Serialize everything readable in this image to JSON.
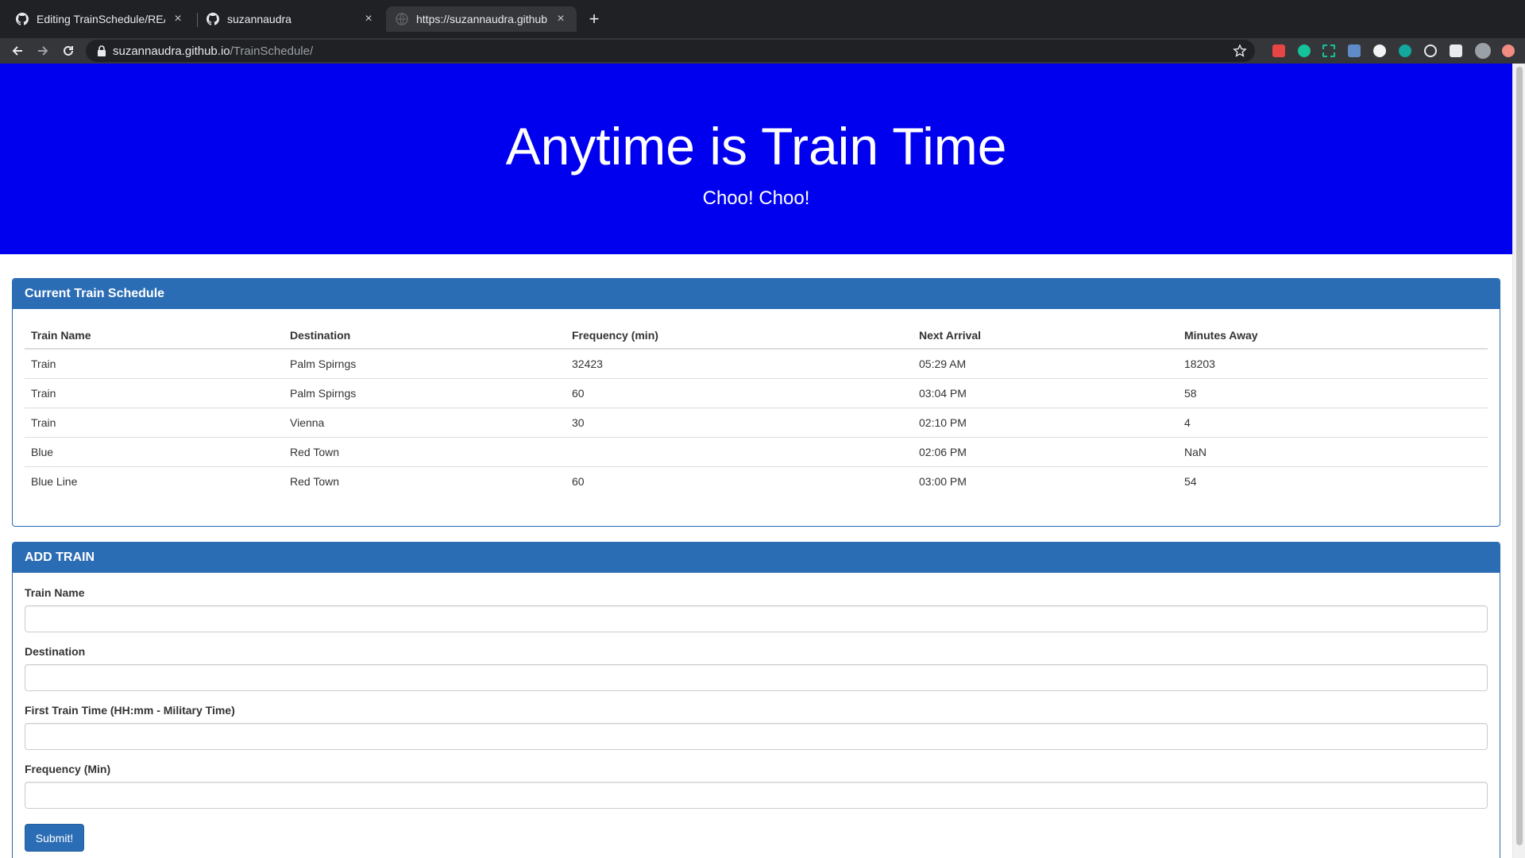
{
  "browser": {
    "tabs": [
      {
        "title": "Editing TrainSchedule/READM",
        "icon": "github-icon"
      },
      {
        "title": "suzannaudra",
        "icon": "github-icon"
      },
      {
        "title": "https://suzannaudra.github.io/",
        "icon": "globe-icon"
      }
    ],
    "new_tab": "+",
    "url_host": "suzannaudra.github.io",
    "url_path": "/TrainSchedule/"
  },
  "jumbotron": {
    "title": "Anytime is Train Time",
    "subtitle": "Choo! Choo!",
    "background": "#0000ee"
  },
  "schedule": {
    "heading": "Current Train Schedule",
    "columns": [
      "Train Name",
      "Destination",
      "Frequency (min)",
      "Next Arrival",
      "Minutes Away"
    ],
    "rows": [
      [
        "Train",
        "Palm Spirngs",
        "32423",
        "05:29 AM",
        "18203"
      ],
      [
        "Train",
        "Palm Spirngs",
        "60",
        "03:04 PM",
        "58"
      ],
      [
        "Train",
        "Vienna",
        "30",
        "02:10 PM",
        "4"
      ],
      [
        "Blue",
        "Red Town",
        "",
        "02:06 PM",
        "NaN"
      ],
      [
        "Blue Line",
        "Red Town",
        "60",
        "03:00 PM",
        "54"
      ]
    ]
  },
  "add_train": {
    "heading": "ADD TRAIN",
    "fields": [
      {
        "label": "Train Name",
        "value": ""
      },
      {
        "label": "Destination",
        "value": ""
      },
      {
        "label": "First Train Time (HH:mm - Military Time)",
        "value": ""
      },
      {
        "label": "Frequency (Min)",
        "value": ""
      }
    ],
    "submit_label": "Submit!"
  },
  "colors": {
    "panel_heading": "#2b6db5",
    "panel_border": "#286ab0"
  }
}
